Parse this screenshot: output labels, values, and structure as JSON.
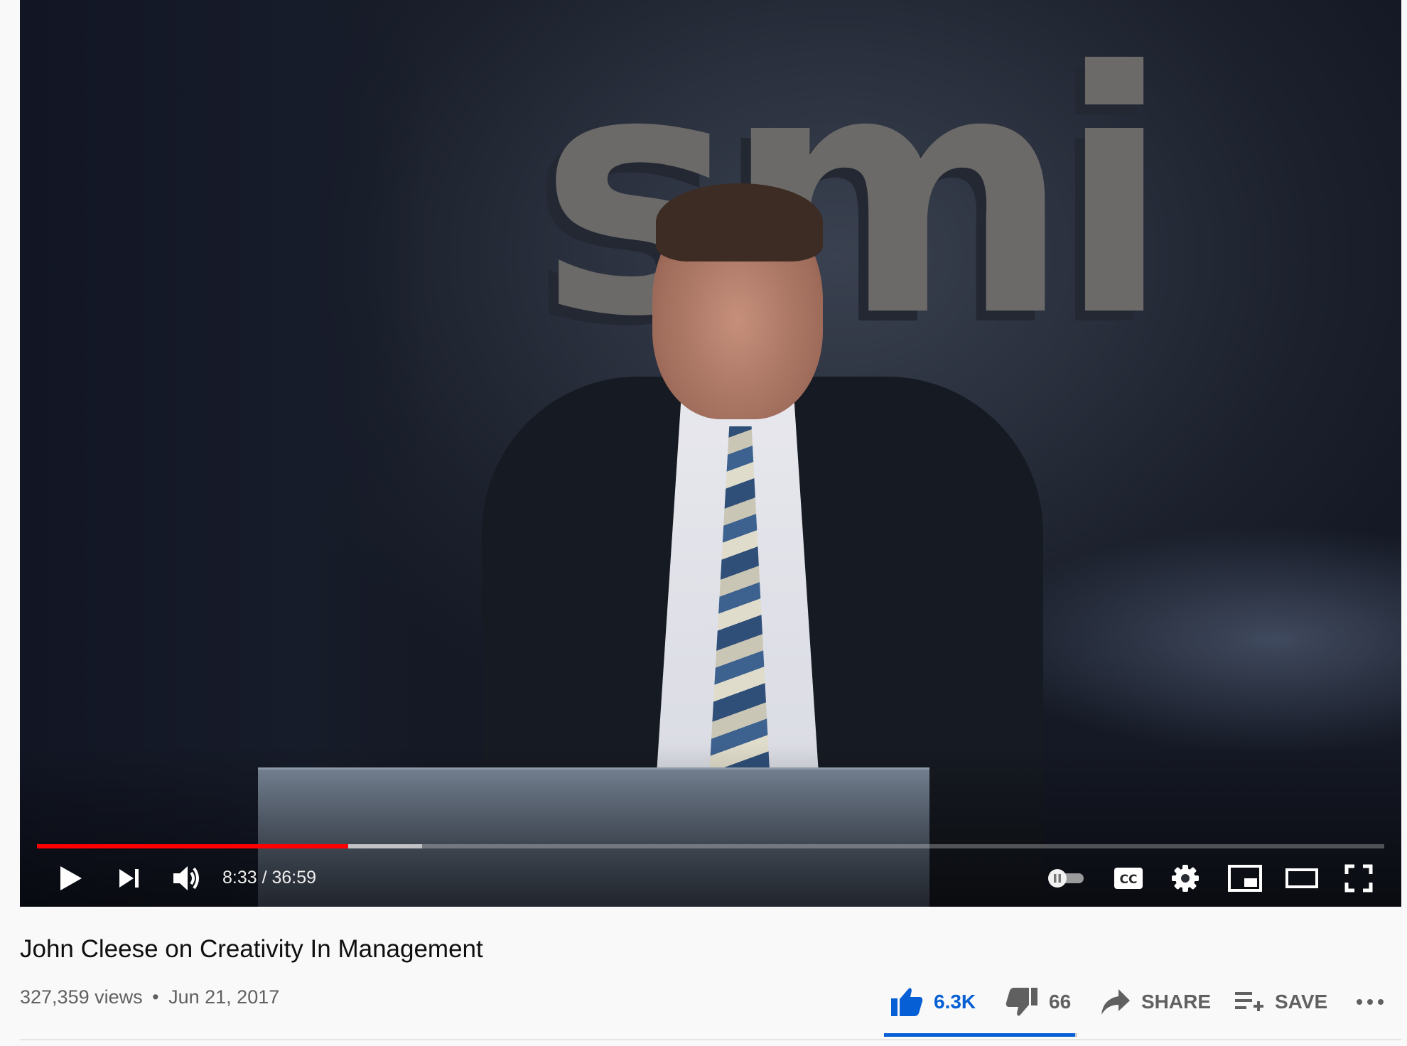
{
  "player": {
    "current_time": "8:33",
    "duration": "36:59",
    "time_display": "8:33 / 36:59",
    "played_fraction": 0.231,
    "buffered_fraction": 0.286,
    "icons": [
      "play-icon",
      "next-icon",
      "volume-icon",
      "autoplay-toggle-icon",
      "captions-icon",
      "settings-icon",
      "miniplayer-icon",
      "theater-icon",
      "fullscreen-icon"
    ],
    "captions_label": "CC",
    "scene_logo_text": "smi",
    "colors": {
      "progress_played": "#ff0000",
      "controls": "#ffffff"
    }
  },
  "video": {
    "title": "John Cleese on Creativity In Management",
    "views": "327,359 views",
    "separator": "•",
    "date": "Jun 21, 2017"
  },
  "actions": {
    "like_count": "6.3K",
    "dislike_count": "66",
    "share_label": "SHARE",
    "save_label": "SAVE",
    "like_fraction": 0.99,
    "colors": {
      "like_active": "#065fd4",
      "inactive": "#606060"
    }
  }
}
